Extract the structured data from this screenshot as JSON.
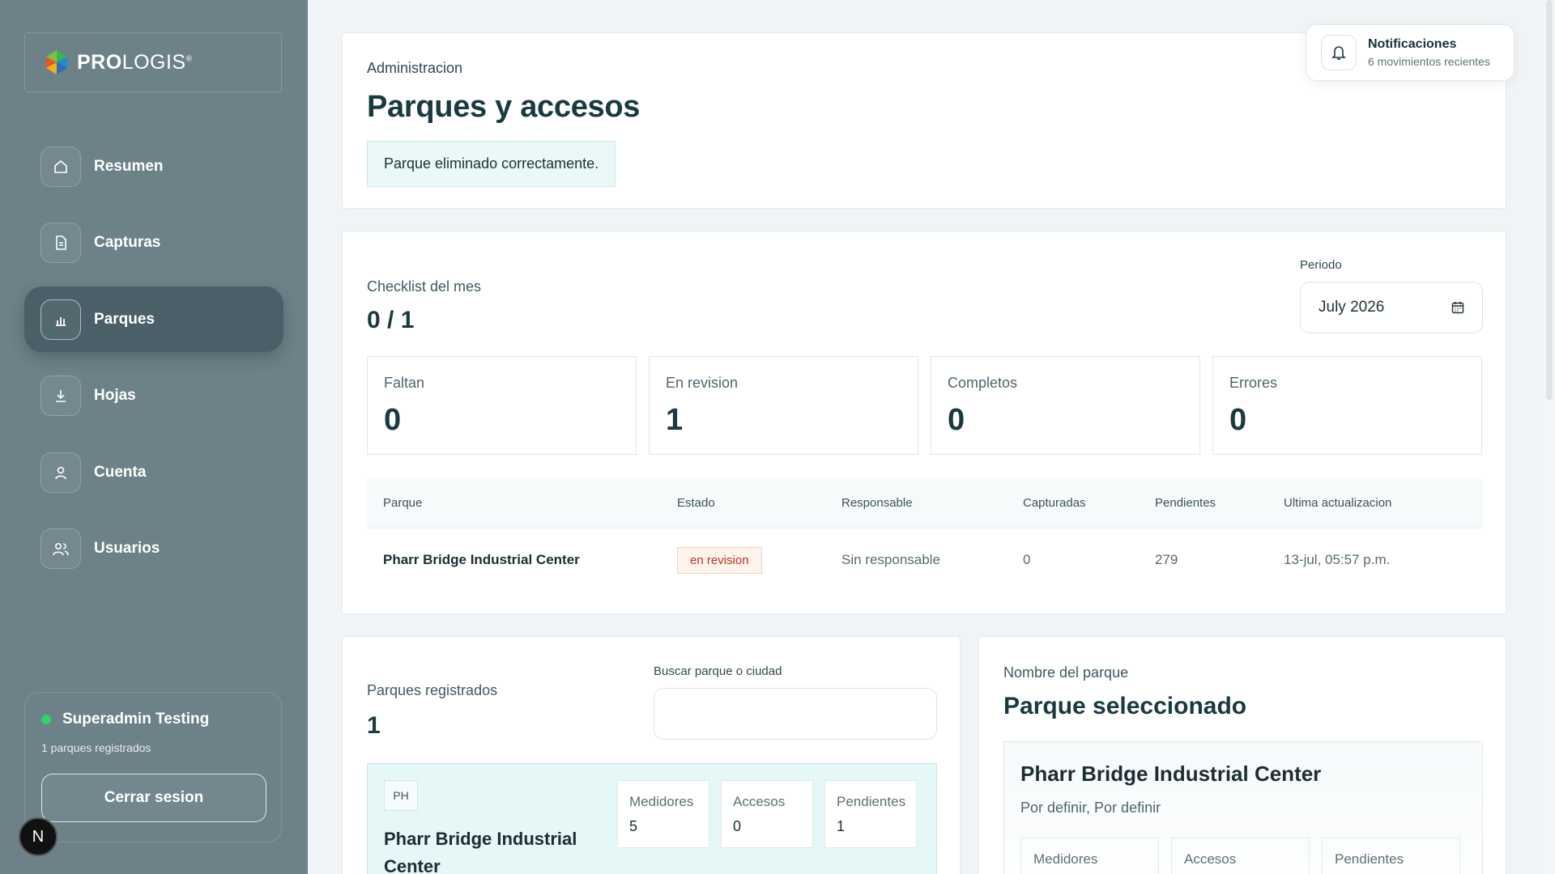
{
  "brand": {
    "name_bold": "PRO",
    "name_light": "LOGIS",
    "reg_mark": "®"
  },
  "nav": {
    "items": [
      {
        "label": "Resumen",
        "icon": "home-icon"
      },
      {
        "label": "Capturas",
        "icon": "document-icon"
      },
      {
        "label": "Parques",
        "icon": "bar-chart-icon",
        "active": true
      },
      {
        "label": "Hojas",
        "icon": "download-icon"
      },
      {
        "label": "Cuenta",
        "icon": "user-icon"
      },
      {
        "label": "Usuarios",
        "icon": "users-icon"
      }
    ]
  },
  "user": {
    "name": "Superadmin Testing",
    "subtitle": "1 parques registrados",
    "logout_label": "Cerrar sesion",
    "status_color": "#2fd36b"
  },
  "n_badge": "N",
  "header": {
    "eyebrow": "Administracion",
    "title": "Parques y accesos",
    "alert": "Parque eliminado correctamente."
  },
  "notifications": {
    "title": "Notificaciones",
    "subtitle": "6 movimientos recientes"
  },
  "checklist": {
    "label": "Checklist del mes",
    "value": "0 / 1",
    "period_label": "Periodo",
    "period_value": "July 2026",
    "stats": [
      {
        "label": "Faltan",
        "value": "0"
      },
      {
        "label": "En revision",
        "value": "1"
      },
      {
        "label": "Completos",
        "value": "0"
      },
      {
        "label": "Errores",
        "value": "0"
      }
    ],
    "table": {
      "headers": [
        "Parque",
        "Estado",
        "Responsable",
        "Capturadas",
        "Pendientes",
        "Ultima actualizacion"
      ],
      "rows": [
        {
          "parque": "Pharr Bridge Industrial Center",
          "estado": "en revision",
          "responsable": "Sin responsable",
          "capturadas": "0",
          "pendientes": "279",
          "actualizacion": "13-jul, 05:57 p.m."
        }
      ]
    }
  },
  "registered": {
    "label": "Parques registrados",
    "value": "1",
    "search_label": "Buscar parque o ciudad",
    "search_value": "",
    "parks": [
      {
        "badge": "PH",
        "name": "Pharr Bridge Industrial Center",
        "stats": [
          {
            "label": "Medidores",
            "value": "5"
          },
          {
            "label": "Accesos",
            "value": "0"
          },
          {
            "label": "Pendientes",
            "value": "1"
          }
        ]
      }
    ]
  },
  "selected": {
    "label": "Nombre del parque",
    "title": "Parque seleccionado",
    "park_name": "Pharr Bridge Industrial Center",
    "location": "Por definir, Por definir",
    "stats": [
      "Medidores",
      "Accesos",
      "Pendientes"
    ]
  }
}
